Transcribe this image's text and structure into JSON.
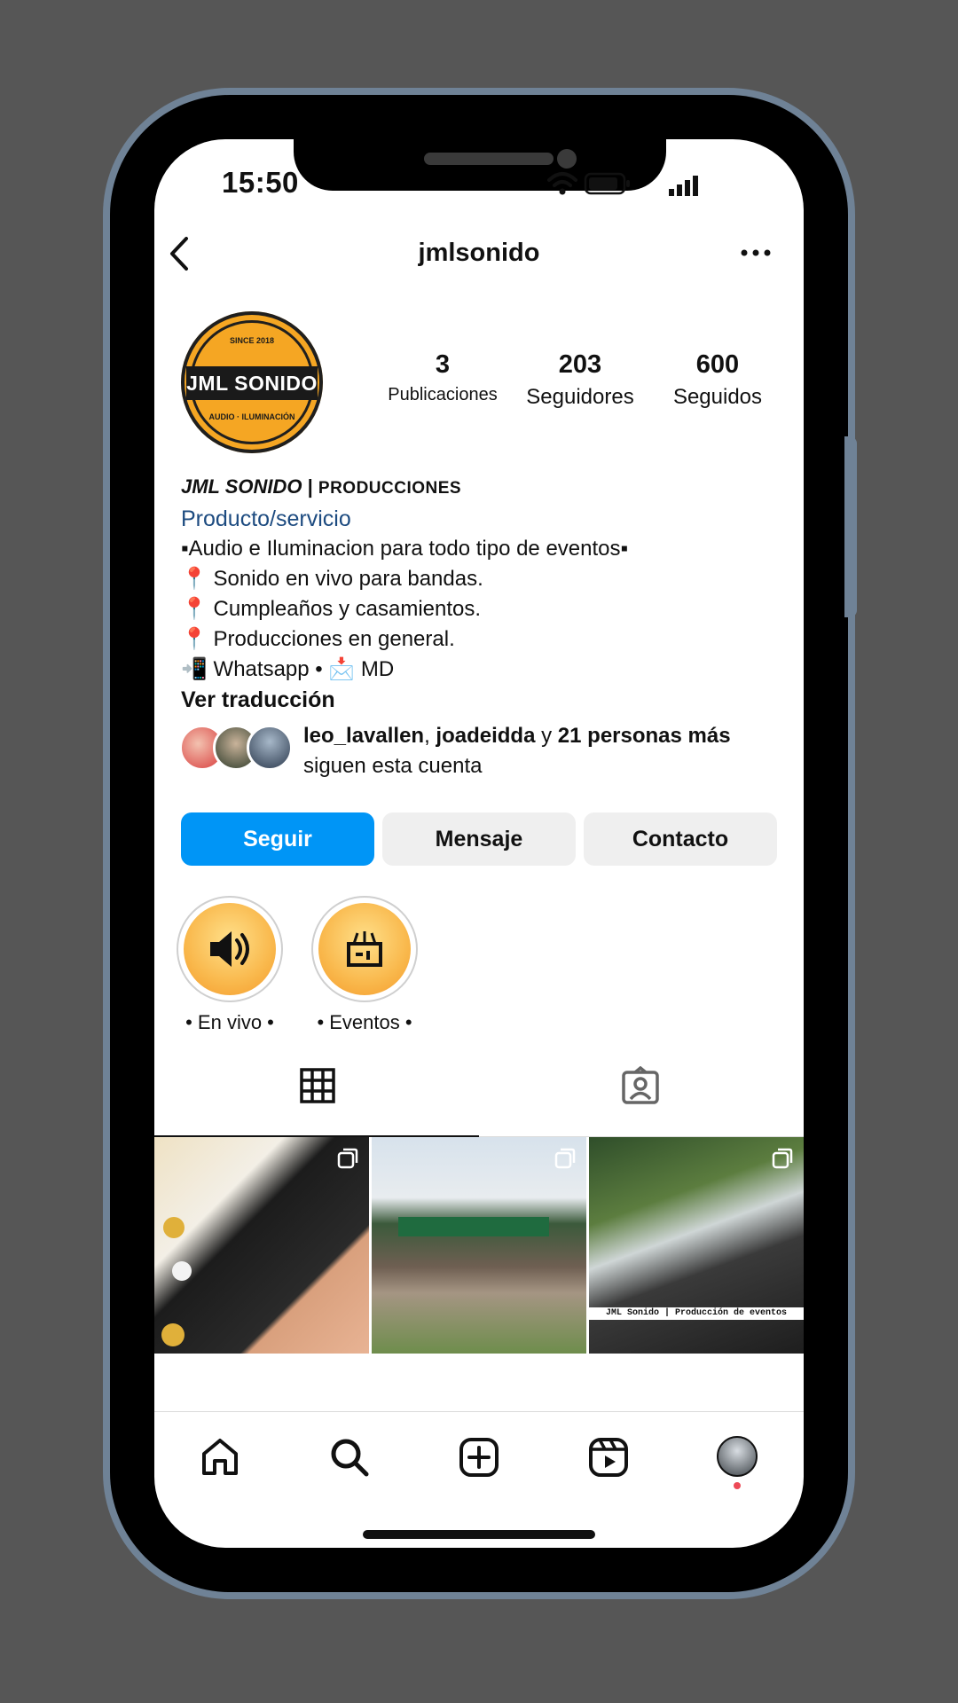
{
  "status": {
    "time": "15:50"
  },
  "header": {
    "username": "jmlsonido"
  },
  "profile": {
    "logo_text": "JML SONIDO",
    "logo_top": "SINCE 2018",
    "logo_bottom": "AUDIO · ILUMINACIÓN",
    "stats": [
      {
        "value": "3",
        "label": "Publicaciones"
      },
      {
        "value": "203",
        "label": "Seguidores"
      },
      {
        "value": "600",
        "label": "Seguidos"
      }
    ],
    "name_italic": "JML SONIDO",
    "name_sep": " | ",
    "name_rest": "PRODUCCIONES",
    "category": "Producto/servicio",
    "bio_lines": [
      "▪Audio e Iluminacion para todo tipo de eventos▪",
      "📍 Sonido en vivo para bandas.",
      "📍 Cumpleaños y casamientos.",
      "📍 Producciones en general.",
      "📲 Whatsapp • 📩 MD"
    ],
    "translate": "Ver traducción",
    "followed_by": {
      "user1": "leo_lavallen",
      "comma": ", ",
      "user2": "joadeidda",
      "and": " y ",
      "others": "21 personas más",
      "rest": "siguen esta cuenta"
    }
  },
  "buttons": {
    "follow": "Seguir",
    "message": "Mensaje",
    "contact": "Contacto"
  },
  "highlights": [
    {
      "label": "• En vivo •"
    },
    {
      "label": "• Eventos •"
    }
  ],
  "posts": [
    {
      "caption": ""
    },
    {
      "caption": ""
    },
    {
      "caption": "JML Sonido | Producción de eventos"
    }
  ],
  "colors": {
    "follow": "#0095f6",
    "category": "#1d4b80",
    "logo": "#f5a623",
    "notification_dot": "#ed4956"
  }
}
